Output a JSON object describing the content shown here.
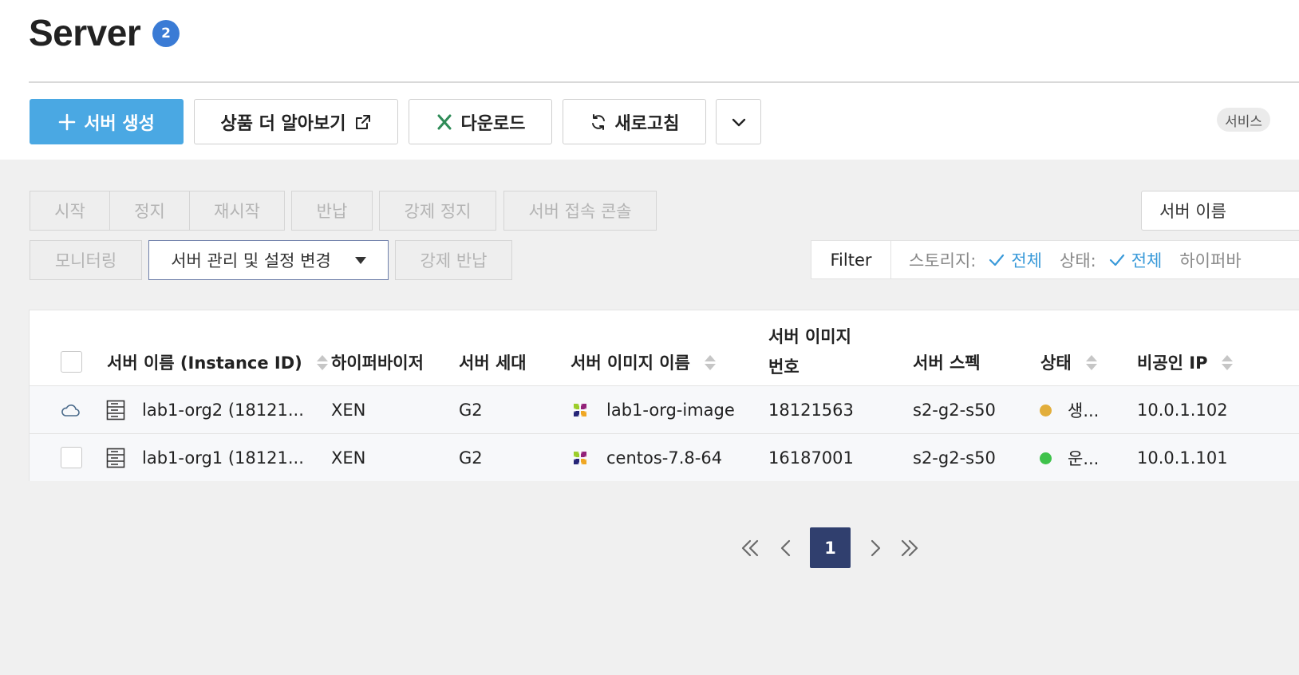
{
  "page": {
    "title": "Server",
    "count_badge": "2"
  },
  "toolbar": {
    "create_label": "서버 생성",
    "learn_more_label": "상품 더 알아보기",
    "download_label": "다운로드",
    "refresh_label": "새로고침",
    "service_chip": "서비스"
  },
  "actions": {
    "start": "시작",
    "stop": "정지",
    "restart": "재시작",
    "return": "반납",
    "force_stop": "강제 정지",
    "console": "서버 접속 콘솔",
    "monitoring": "모니터링",
    "manage": "서버 관리 및 설정 변경",
    "force_return": "강제 반납"
  },
  "search": {
    "field_label": "서버 이름"
  },
  "filter": {
    "label": "Filter",
    "storage_key": "스토리지:",
    "storage_value": "전체",
    "status_key": "상태:",
    "status_value": "전체",
    "hypervisor_key": "하이퍼바"
  },
  "table": {
    "columns": {
      "name": "서버 이름 (Instance ID)",
      "hypervisor": "하이퍼바이저",
      "generation": "서버 세대",
      "image_name": "서버 이미지 이름",
      "image_number_line1": "서버 이미지",
      "image_number_line2": "번호",
      "spec": "서버 스펙",
      "status": "상태",
      "private_ip": "비공인 IP"
    },
    "rows": [
      {
        "name": "lab1-org2 (18121...",
        "hypervisor": "XEN",
        "generation": "G2",
        "image_name": "lab1-org-image",
        "image_number": "18121563",
        "spec": "s2-g2-s50",
        "status": "생...",
        "status_color": "#e2ae3b",
        "private_ip": "10.0.1.102"
      },
      {
        "name": "lab1-org1 (18121...",
        "hypervisor": "XEN",
        "generation": "G2",
        "image_name": "centos-7.8-64",
        "image_number": "16187001",
        "spec": "s2-g2-s50",
        "status": "운...",
        "status_color": "#3fc24b",
        "private_ip": "10.0.1.101"
      }
    ]
  },
  "pagination": {
    "current_page": "1"
  },
  "colors": {
    "primary": "#4aa8e3",
    "badge": "#3a7bd5",
    "page_active": "#303f6e",
    "link": "#3a9ad9"
  }
}
